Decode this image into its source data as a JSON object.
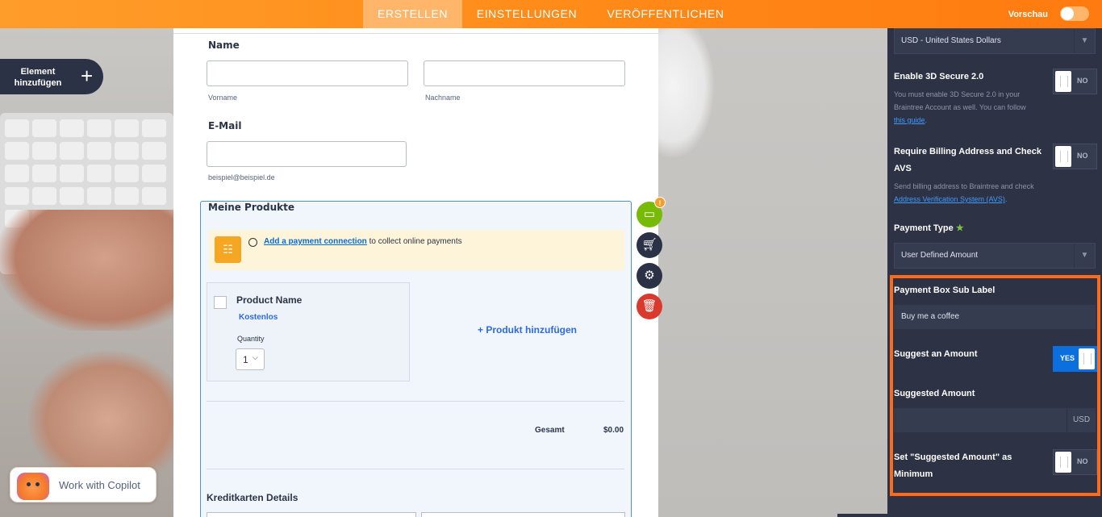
{
  "topbar": {
    "tabs": [
      "ERSTELLEN",
      "EINSTELLUNGEN",
      "VERÖFFENTLICHEN"
    ],
    "preview_label": "Vorschau"
  },
  "add_element": {
    "label": "Element hinzufügen"
  },
  "copilot": {
    "label": "Work with Copilot"
  },
  "form": {
    "name_label": "Name",
    "first_name_sub": "Vorname",
    "last_name_sub": "Nachname",
    "email_label": "E-Mail",
    "email_sub": "beispiel@beispiel.de",
    "products_title": "Meine Produkte",
    "notice_link": "Add a payment connection",
    "notice_text": " to collect online payments",
    "product_name": "Product Name",
    "product_price": "Kostenlos",
    "quantity_label": "Quantity",
    "quantity_value": "1",
    "add_product": "+ Produkt hinzufügen",
    "total_label": "Gesamt",
    "total_value": "$0.00",
    "credit_card_label": "Kreditkarten Details"
  },
  "fab": {
    "badge": "!"
  },
  "panel": {
    "currency_value": "USD - United States Dollars",
    "secure_title": "Enable 3D Secure 2.0",
    "secure_desc_1": "You must enable 3D Secure 2.0 in your",
    "secure_desc_2": "Braintree Account as well. You can follow",
    "secure_link": "this guide",
    "secure_desc_end": ".",
    "secure_toggle": "NO",
    "billing_title_1": "Require Billing Address and Check",
    "billing_title_2": "AVS",
    "billing_desc": "Send billing address to Braintree and check",
    "billing_link": "Address Verification System (AVS)",
    "billing_desc_end": ".",
    "billing_toggle": "NO",
    "payment_type_label": "Payment Type",
    "payment_type_value": "User Defined Amount",
    "sub_label_title": "Payment Box Sub Label",
    "sub_label_value": "Buy me a coffee",
    "suggest_title": "Suggest an Amount",
    "suggest_toggle": "YES",
    "suggested_amount_title": "Suggested Amount",
    "suggested_amount_unit": "USD",
    "minimum_title_1": "Set \"Suggested Amount\" as",
    "minimum_title_2": "Minimum",
    "minimum_toggle": "NO"
  },
  "colors": {
    "topbar": "#ff8a18",
    "panel": "#2d3244",
    "highlight": "#ff6b1a",
    "link": "#0a6ad6",
    "toggle_on": "#0b6fde"
  }
}
